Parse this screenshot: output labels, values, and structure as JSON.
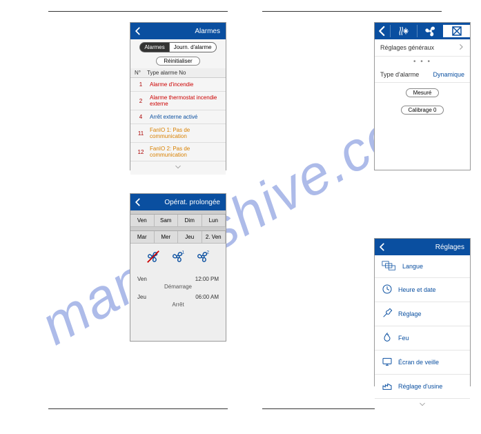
{
  "watermark": "manualshive.com",
  "phone1": {
    "title": "Alarmes",
    "seg_active": "Alarmes",
    "seg_other": "Journ. d'alarme",
    "reset": "Réinitialiser",
    "col_no": "N°",
    "col_type": "Type alarme No",
    "rows": [
      {
        "n": "1",
        "t": "Alarme d'incendie",
        "cls": "red"
      },
      {
        "n": "2",
        "t": "Alarme thermostat incendie externe",
        "cls": "red"
      },
      {
        "n": "4",
        "t": "Arrêt externe activé",
        "cls": "blue"
      },
      {
        "n": "11",
        "t": "FanIO 1: Pas de communication",
        "cls": "orange"
      },
      {
        "n": "12",
        "t": "FanIO 2: Pas de communication",
        "cls": "orange"
      }
    ]
  },
  "phone2": {
    "title": "Opérat. prolongée",
    "days1": [
      "Ven",
      "Sam",
      "Dim",
      "Lun"
    ],
    "days2": [
      "Mar",
      "Mer",
      "Jeu",
      "2. Ven"
    ],
    "start_day": "Ven",
    "start_time": "12:00 PM",
    "start_lbl": "Démarrage",
    "stop_day": "Jeu",
    "stop_time": "06:00 AM",
    "stop_lbl": "Arrêt"
  },
  "phone3": {
    "gen_label": "Réglages généraux",
    "type_label": "Type d'alarme",
    "type_value": "Dynamique",
    "measured": "Mesuré",
    "calib": "Calibrage 0"
  },
  "phone4": {
    "title": "Réglages",
    "items": [
      {
        "icon": "lang",
        "label": "Langue"
      },
      {
        "icon": "clock",
        "label": "Heure et date"
      },
      {
        "icon": "wrench",
        "label": "Réglage"
      },
      {
        "icon": "fire",
        "label": "Feu"
      },
      {
        "icon": "screen",
        "label": "Écran de veille"
      },
      {
        "icon": "factory",
        "label": "Réglage d'usine"
      }
    ]
  }
}
